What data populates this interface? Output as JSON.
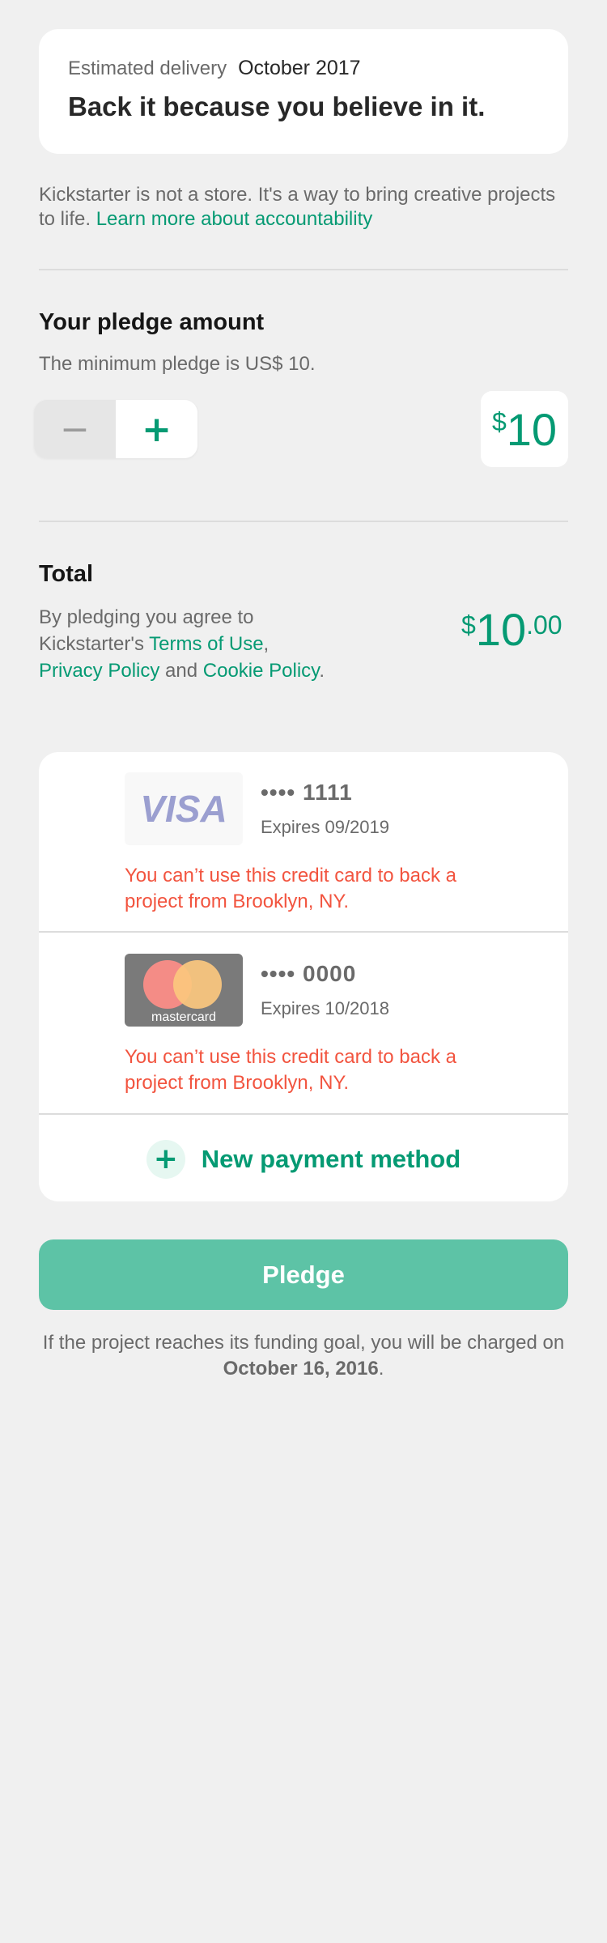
{
  "delivery": {
    "label": "Estimated delivery",
    "date": "October 2017",
    "tagline": "Back it because you believe in it."
  },
  "info": {
    "text": "Kickstarter is not a store. It's a way to bring creative projects to life.",
    "link": "Learn more about accountability"
  },
  "pledge_amount": {
    "title": "Your pledge amount",
    "minimum_text": "The minimum pledge is US$ 10.",
    "minus_symbol": "−",
    "plus_symbol": "+",
    "currency": "$",
    "value": "10"
  },
  "total": {
    "title": "Total",
    "terms_prefix": "By pledging you agree to Kickstarter's",
    "terms_link": "Terms of Use",
    "comma": ",",
    "privacy_link": "Privacy Policy",
    "and": "and",
    "cookie_link": "Cookie Policy",
    "period": ".",
    "currency": "$",
    "amount_int": "10",
    "amount_dec": ".00"
  },
  "payment_methods": [
    {
      "brand": "VISA",
      "number": "•••• 1111",
      "expiry": "Expires 09/2019",
      "error": "You can’t use this credit card to back a project from Brooklyn, NY.",
      "brand_color": "#9b9fd0"
    },
    {
      "brand": "mastercard",
      "number": "•••• 0000",
      "expiry": "Expires 10/2018",
      "error": "You can’t use this credit card to back a project from Brooklyn, NY.",
      "brand_colors": [
        "#f48c86",
        "#fbc77e"
      ]
    }
  ],
  "new_payment": {
    "icon": "plus-icon",
    "icon_symbol": "+",
    "label": "New payment method"
  },
  "pledge_button": {
    "label": "Pledge"
  },
  "footer": {
    "text_prefix": "If the project reaches its funding goal, you will be charged on",
    "date": "October 16, 2016",
    "period": "."
  },
  "colors": {
    "accent": "#059a73",
    "button": "#5dc3a6",
    "error": "#f2543f",
    "background": "#f0f0f0"
  }
}
